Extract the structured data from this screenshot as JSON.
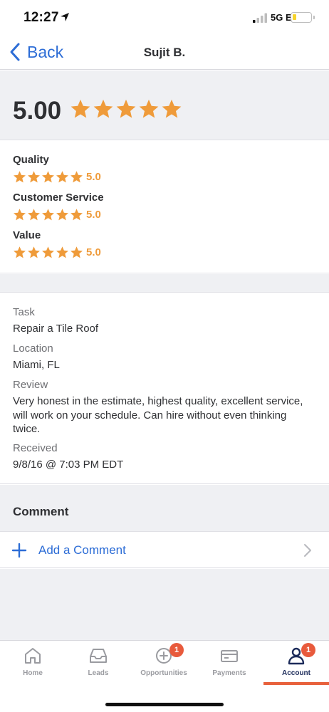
{
  "status_bar": {
    "time": "12:27",
    "network": "5G E"
  },
  "nav": {
    "back_label": "Back",
    "title": "Sujit B."
  },
  "overall": {
    "score": "5.00",
    "stars": 5
  },
  "ratings": [
    {
      "label": "Quality",
      "value": "5.0"
    },
    {
      "label": "Customer Service",
      "value": "5.0"
    },
    {
      "label": "Value",
      "value": "5.0"
    }
  ],
  "details": {
    "task_label": "Task",
    "task_value": "Repair a Tile Roof",
    "location_label": "Location",
    "location_value": "Miami, FL",
    "review_label": "Review",
    "review_value": "Very honest in the estimate, highest quality, excellent service, will work on your schedule. Can hire without even thinking twice.",
    "received_label": "Received",
    "received_value": "9/8/16 @ 7:03 PM EDT"
  },
  "comment": {
    "title": "Comment",
    "add_label": "Add a Comment"
  },
  "tabs": [
    {
      "label": "Home",
      "icon": "home-icon"
    },
    {
      "label": "Leads",
      "icon": "inbox-icon"
    },
    {
      "label": "Opportunities",
      "icon": "plus-circle-icon",
      "badge": "1"
    },
    {
      "label": "Payments",
      "icon": "credit-card-icon"
    },
    {
      "label": "Account",
      "icon": "person-icon",
      "badge": "1",
      "active": true
    }
  ],
  "colors": {
    "accent_blue": "#2d6dd6",
    "star": "#ef9b3a",
    "badge": "#e85a3c",
    "active_tab": "#1c2b5a"
  }
}
